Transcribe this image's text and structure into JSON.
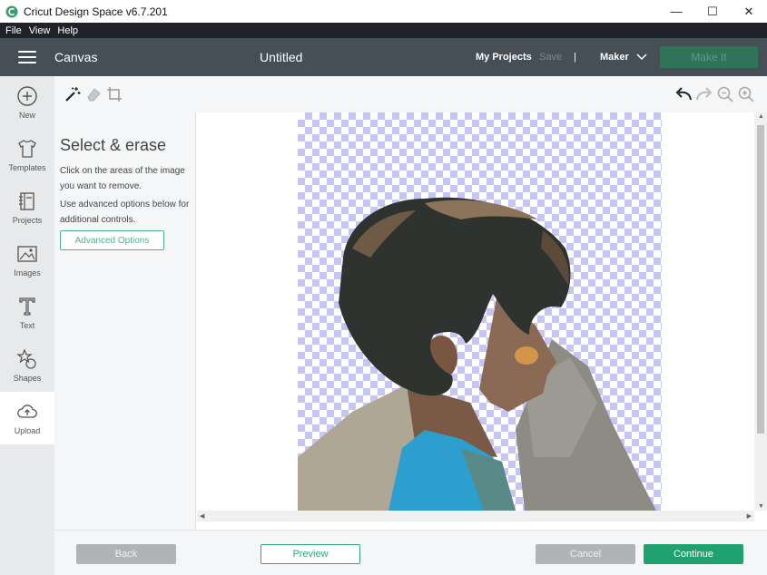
{
  "window": {
    "title": "Cricut Design Space  v6.7.201",
    "minimize": "—",
    "maximize": "☐",
    "close": "✕"
  },
  "menu": [
    "File",
    "View",
    "Help"
  ],
  "header": {
    "section": "Canvas",
    "document_title": "Untitled",
    "my_projects": "My Projects",
    "save": "Save",
    "separator": "|",
    "machine": "Maker",
    "make_it": "Make It"
  },
  "nav": [
    {
      "label": "New",
      "icon": "plus-circle-icon"
    },
    {
      "label": "Templates",
      "icon": "tshirt-icon"
    },
    {
      "label": "Projects",
      "icon": "notebook-icon"
    },
    {
      "label": "Images",
      "icon": "image-icon"
    },
    {
      "label": "Text",
      "icon": "text-t-icon"
    },
    {
      "label": "Shapes",
      "icon": "shapes-icon"
    },
    {
      "label": "Upload",
      "icon": "cloud-upload-icon"
    }
  ],
  "toolbar": {
    "tools": [
      "magic-wand-icon",
      "eraser-icon",
      "crop-icon"
    ],
    "right_tools": [
      "undo-icon",
      "redo-icon",
      "zoom-out-icon",
      "zoom-in-icon"
    ]
  },
  "panel": {
    "heading": "Select & erase",
    "instruction1": "Click on the areas of the image you want to remove.",
    "instruction2": "Use advanced options below for additional controls.",
    "advanced_button": "Advanced Options"
  },
  "footer": {
    "back": "Back",
    "preview": "Preview",
    "cancel": "Cancel",
    "continue": "Continue"
  },
  "colors": {
    "header_bg": "#464f55",
    "accent_green": "#1fa26f",
    "checker": "#c7c5f4"
  }
}
